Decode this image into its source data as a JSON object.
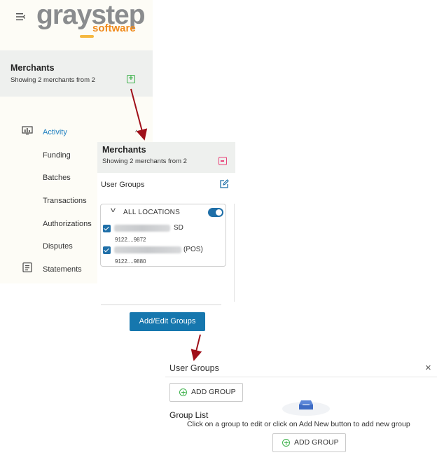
{
  "logo": {
    "main": "graystep",
    "sub": "software"
  },
  "sidebar": {
    "merchants_title": "Merchants",
    "merchants_sub": "Showing 2 merchants from 2",
    "nav": [
      {
        "label": "Activity",
        "icon": "monitor-chart-icon",
        "active": true
      },
      {
        "label": "Funding"
      },
      {
        "label": "Batches"
      },
      {
        "label": "Transactions"
      },
      {
        "label": "Authorizations"
      },
      {
        "label": "Disputes"
      },
      {
        "label": "Statements",
        "icon": "statement-document-icon"
      }
    ]
  },
  "popup1": {
    "title": "Merchants",
    "sub": "Showing 2 merchants from 2",
    "user_groups": "User Groups",
    "all_locations": "ALL LOCATIONS",
    "locations": [
      {
        "tag": "SD",
        "id": "9122....9872"
      },
      {
        "tag": "(POS)",
        "id": "9122....9880"
      }
    ],
    "button": "Add/Edit Groups"
  },
  "popup2": {
    "title": "User Groups",
    "close": "×",
    "add_group": "ADD GROUP",
    "group_list": "Group List",
    "hint": "Click on a group to edit or click on Add New button to add new group"
  },
  "colors": {
    "accent": "#1677ae",
    "link": "#1f7fc0",
    "green": "#3cb14a",
    "pink": "#e8457a",
    "arrow": "#a0101a",
    "logo_gray": "#8a8c8e",
    "logo_orange": "#f08a1c"
  }
}
